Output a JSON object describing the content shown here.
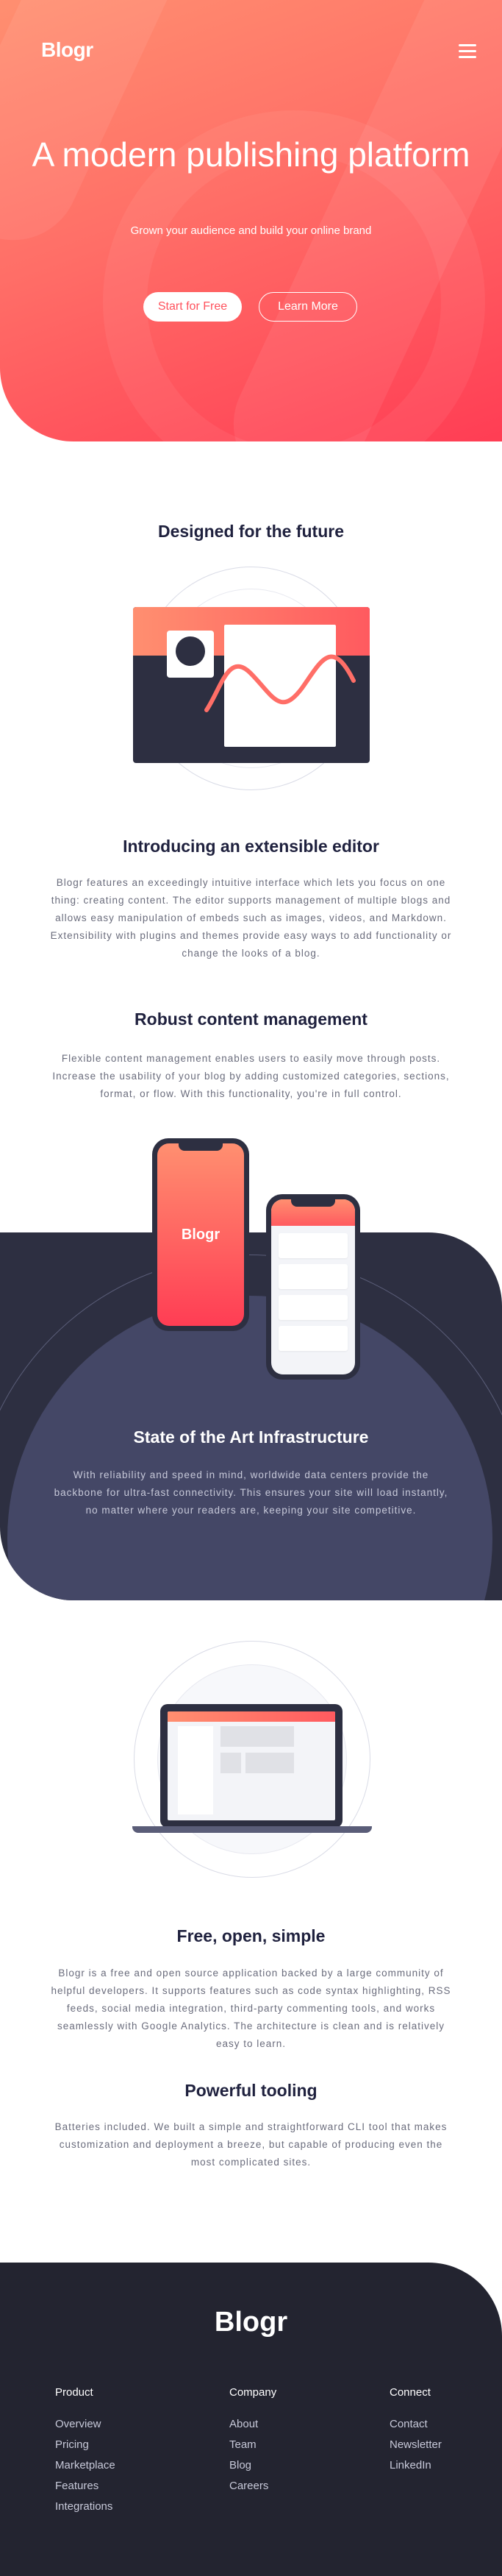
{
  "header": {
    "logo": "Blogr",
    "menu_icon": "hamburger-icon",
    "title": "A modern publishing platform",
    "subtitle": "Grown your audience and build your online brand",
    "start_label": "Start for Free",
    "learn_label": "Learn More"
  },
  "designed": {
    "title": "Designed for the future",
    "items": [
      {
        "title": "Introducing an extensible editor",
        "body": "Blogr features an exceedingly intuitive interface which lets you focus on one thing: creating content. The editor supports management of multiple blogs and allows easy manipulation of embeds such as images, videos, and Markdown. Extensibility with plugins and themes provide easy ways to add functionality or change the looks of a blog."
      },
      {
        "title": "Robust content management",
        "body": "Flexible content management enables users to easily move through posts. Increase the usability of your blog by adding customized categories, sections, format, or flow. With this functionality, you're in full control."
      }
    ]
  },
  "infrastructure": {
    "phone_logo": "Blogr",
    "title": "State of the Art Infrastructure",
    "body": "With reliability and speed in mind, worldwide data centers provide the backbone for ultra-fast connectivity. This ensures your site will load instantly, no matter where your readers are, keeping your site competitive."
  },
  "features": {
    "items": [
      {
        "title": "Free, open, simple",
        "body": "Blogr is a free and open source application backed by a large community of helpful developers. It supports features such as code syntax highlighting, RSS feeds, social media integration, third-party commenting tools, and works seamlessly with Google Analytics. The architecture is clean and is relatively easy to learn."
      },
      {
        "title": "Powerful tooling",
        "body": "Batteries included. We built a simple and straightforward CLI tool that makes customization and deployment a breeze, but capable of producing even the most complicated sites."
      }
    ]
  },
  "footer": {
    "logo": "Blogr",
    "columns": [
      {
        "heading": "Product",
        "links": [
          "Overview",
          "Pricing",
          "Marketplace",
          "Features",
          "Integrations"
        ]
      },
      {
        "heading": "Company",
        "links": [
          "About",
          "Team",
          "Blog",
          "Careers"
        ]
      },
      {
        "heading": "Connect",
        "links": [
          "Contact",
          "Newsletter",
          "LinkedIn"
        ]
      }
    ]
  },
  "colors": {
    "brand_gradient_start": "#ff8f70",
    "brand_gradient_end": "#ff3d54",
    "dark_navy": "#2d2f41",
    "footer_bg": "#232430",
    "text_dark": "#1f213e",
    "text_gray": "#6a6c7c"
  }
}
